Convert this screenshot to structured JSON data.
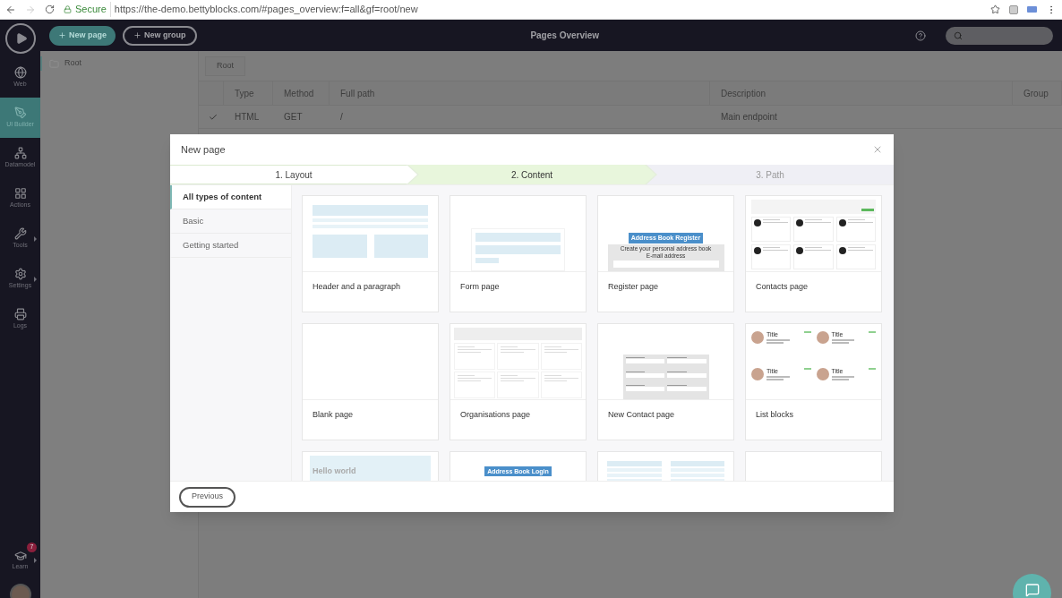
{
  "browser": {
    "secure_label": "Secure",
    "url": "https://the-demo.bettyblocks.com/#pages_overview:f=all&gf=root/new"
  },
  "sidebar": {
    "items": [
      {
        "label": "Web",
        "selected": false,
        "submenu": false
      },
      {
        "label": "UI Builder",
        "selected": true,
        "submenu": false
      },
      {
        "label": "Datamodel",
        "selected": false,
        "submenu": false
      },
      {
        "label": "Actions",
        "selected": false,
        "submenu": false
      },
      {
        "label": "Tools",
        "selected": false,
        "submenu": true
      },
      {
        "label": "Settings",
        "selected": false,
        "submenu": true
      },
      {
        "label": "Logs",
        "selected": false,
        "submenu": false
      }
    ],
    "learn": {
      "label": "Learn",
      "badge": "7",
      "submenu": true
    }
  },
  "topbar": {
    "buttons": [
      {
        "label": "New page",
        "kind": "primary"
      },
      {
        "label": "New group",
        "kind": "outline"
      }
    ],
    "title": "Pages Overview"
  },
  "tree": {
    "items": [
      {
        "label": "Root",
        "selected": true
      }
    ]
  },
  "breadcrumb": "Root",
  "table": {
    "columns": [
      "Type",
      "Method",
      "Full path",
      "Description",
      "Group"
    ],
    "rows": [
      {
        "active": true,
        "type": "HTML",
        "method": "GET",
        "full_path": "/",
        "description": "Main endpoint"
      }
    ]
  },
  "modal": {
    "title": "New page",
    "steps": [
      {
        "label": "1. Layout",
        "selected": false,
        "completed": true
      },
      {
        "label": "2. Content",
        "selected": true,
        "completed": false
      },
      {
        "label": "3. Path",
        "selected": false,
        "completed": false
      }
    ],
    "categories": [
      {
        "label": "All types of content",
        "selected": true
      },
      {
        "label": "Basic",
        "selected": false
      },
      {
        "label": "Getting started",
        "selected": false
      }
    ],
    "cards": [
      {
        "title": "Header and a paragraph",
        "preview": {
          "kind": "header_paragraph"
        }
      },
      {
        "title": "Form page",
        "preview": {
          "kind": "form"
        }
      },
      {
        "title": "Register page",
        "preview": {
          "kind": "register",
          "heading": "Address Book Register",
          "lines": [
            "Create your personal address book",
            "E-mail address"
          ]
        }
      },
      {
        "title": "Contacts page",
        "preview": {
          "kind": "contacts"
        }
      },
      {
        "title": "Blank page",
        "preview": {
          "kind": "blank"
        }
      },
      {
        "title": "Organisations page",
        "preview": {
          "kind": "organisations"
        }
      },
      {
        "title": "New Contact page",
        "preview": {
          "kind": "new_contact"
        }
      },
      {
        "title": "List blocks",
        "preview": {
          "kind": "list_blocks",
          "titles": [
            "Title",
            "Title",
            "Title",
            "Title"
          ]
        }
      },
      {
        "preview": {
          "kind": "hello",
          "heading": "Hello world"
        }
      },
      {
        "preview": {
          "kind": "login",
          "heading": "Address Book Login"
        }
      },
      {
        "preview": {
          "kind": "columns"
        }
      },
      {
        "preview": {
          "kind": "blank"
        }
      }
    ],
    "previous": "Previous"
  }
}
